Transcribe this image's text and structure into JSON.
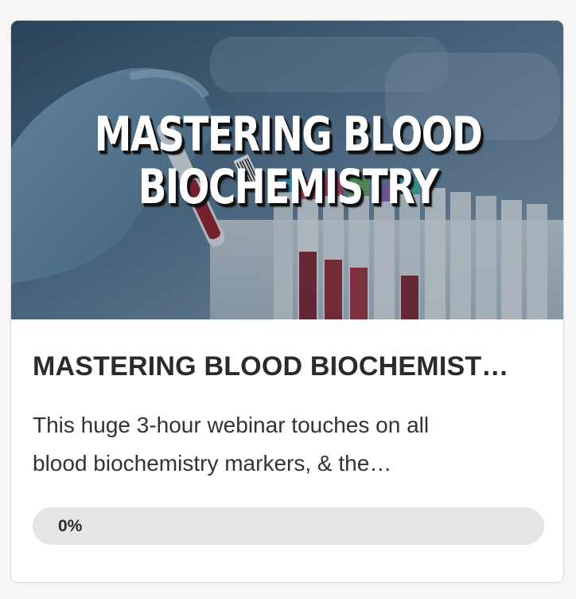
{
  "course": {
    "hero_title_line1": "MASTERING BLOOD",
    "hero_title_line2": "BIOCHEMISTRY",
    "title": "MASTERING BLOOD BIOCHEMIST…",
    "description_line1": "This huge 3-hour webinar touches on all",
    "description_line2": "blood biochemistry markers, & the…",
    "progress_label": "0%",
    "progress_fraction": 0
  },
  "colors": {
    "page_background": "#f7f6f4",
    "card_background": "#ffffff",
    "progress_track": "#e6e6e6",
    "title_text": "#2b2b2b"
  }
}
